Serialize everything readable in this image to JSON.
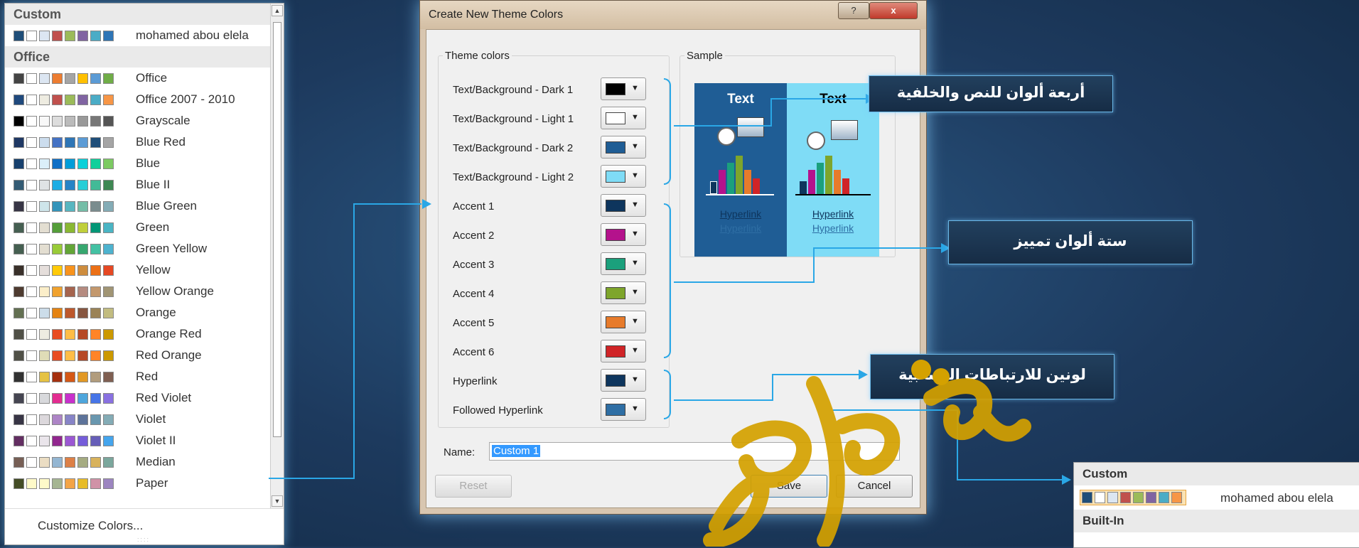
{
  "theme_menu": {
    "custom_header": "Custom",
    "custom_item": {
      "label": "mohamed abou elela",
      "swatches": [
        "#1f4e79",
        "#ffffff",
        "#dce6f2",
        "#c0504d",
        "#9bbb59",
        "#8064a2",
        "#4bacc6",
        "#2e75b6"
      ]
    },
    "office_header": "Office",
    "items": [
      {
        "label": "Office",
        "swatches": [
          "#444",
          "#fff",
          "#dce6f2",
          "#ed7d31",
          "#a5a5a5",
          "#ffc000",
          "#5b9bd5",
          "#70ad47"
        ]
      },
      {
        "label": "Office 2007 - 2010",
        "swatches": [
          "#1f497d",
          "#fff",
          "#eeece1",
          "#c0504d",
          "#9bbb59",
          "#8064a2",
          "#4bacc6",
          "#f79646"
        ]
      },
      {
        "label": "Grayscale",
        "swatches": [
          "#000",
          "#fff",
          "#f8f8f8",
          "#ddd",
          "#bbb",
          "#999",
          "#777",
          "#555"
        ]
      },
      {
        "label": "Blue Red",
        "swatches": [
          "#1f3864",
          "#fff",
          "#ccddee",
          "#4472c4",
          "#2e75b6",
          "#5b9bd5",
          "#1f4e79",
          "#a5a5a5"
        ]
      },
      {
        "label": "Blue",
        "swatches": [
          "#17406d",
          "#fff",
          "#dbeff9",
          "#0f6fc6",
          "#009dd9",
          "#0bd0d9",
          "#10cf9b",
          "#7cca62"
        ]
      },
      {
        "label": "Blue II",
        "swatches": [
          "#335b74",
          "#fff",
          "#dfe3e5",
          "#1cade4",
          "#2683c6",
          "#27ced7",
          "#42ba97",
          "#3e8853"
        ]
      },
      {
        "label": "Blue Green",
        "swatches": [
          "#373545",
          "#fff",
          "#cee5ea",
          "#3494ba",
          "#58b6c0",
          "#75bda7",
          "#7a8c8e",
          "#84acb6"
        ]
      },
      {
        "label": "Green",
        "swatches": [
          "#455f51",
          "#fff",
          "#e3ded1",
          "#549e39",
          "#8ab833",
          "#c0cf3a",
          "#029676",
          "#4ab5c4"
        ]
      },
      {
        "label": "Green Yellow",
        "swatches": [
          "#455f51",
          "#fff",
          "#e3ded1",
          "#99cb38",
          "#63a537",
          "#37a76f",
          "#44c1a3",
          "#4eb3cf"
        ]
      },
      {
        "label": "Yellow",
        "swatches": [
          "#39302a",
          "#fff",
          "#e5dedb",
          "#ffca08",
          "#f8931d",
          "#ce8d3e",
          "#ec7016",
          "#e64823"
        ]
      },
      {
        "label": "Yellow Orange",
        "swatches": [
          "#4e3b30",
          "#fff",
          "#fbeec9",
          "#f0a22e",
          "#a5644e",
          "#b58b80",
          "#c3986d",
          "#a19574"
        ]
      },
      {
        "label": "Orange",
        "swatches": [
          "#637052",
          "#fff",
          "#ccddea",
          "#e48312",
          "#bd582c",
          "#865640",
          "#9b8357",
          "#c2bc80"
        ]
      },
      {
        "label": "Orange Red",
        "swatches": [
          "#505046",
          "#fff",
          "#eeece1",
          "#e84c22",
          "#ffbd47",
          "#b64926",
          "#ff8427",
          "#cc9900"
        ]
      },
      {
        "label": "Red Orange",
        "swatches": [
          "#505046",
          "#fff",
          "#dfdcb7",
          "#e84c22",
          "#ffbd47",
          "#b64926",
          "#ff8427",
          "#cc9900"
        ]
      },
      {
        "label": "Red",
        "swatches": [
          "#323232",
          "#fff",
          "#e5c243",
          "#a5300f",
          "#d55816",
          "#e19825",
          "#b19c7d",
          "#7f5f52"
        ]
      },
      {
        "label": "Red Violet",
        "swatches": [
          "#454551",
          "#fff",
          "#d8d9dc",
          "#e32d91",
          "#c830cc",
          "#4ea6dc",
          "#4775e7",
          "#8971e1"
        ]
      },
      {
        "label": "Violet",
        "swatches": [
          "#373545",
          "#fff",
          "#dcd8dc",
          "#ad84c6",
          "#8784c7",
          "#5d739a",
          "#6997af",
          "#84acb6"
        ]
      },
      {
        "label": "Violet II",
        "swatches": [
          "#632e62",
          "#fff",
          "#eae5eb",
          "#92278f",
          "#9b57d3",
          "#755dd9",
          "#665eb8",
          "#45a5ed"
        ]
      },
      {
        "label": "Median",
        "swatches": [
          "#775f55",
          "#fff",
          "#ebddc3",
          "#94b6d2",
          "#dd8047",
          "#a5ab81",
          "#d8b25c",
          "#7ba79d"
        ]
      },
      {
        "label": "Paper",
        "swatches": [
          "#444d26",
          "#fefac9",
          "#fefac9",
          "#a5b592",
          "#f3a447",
          "#e7bc29",
          "#d092a7",
          "#9c85c0"
        ]
      }
    ],
    "customize_label": "Customize Colors...",
    "customize_mnemonic": "C"
  },
  "dialog": {
    "title": "Create New Theme Colors",
    "help_glyph": "?",
    "close_glyph": "x",
    "theme_colors_legend": "Theme colors",
    "sample_legend": "Sample",
    "color_rows": [
      {
        "label": "Text/Background - Dark 1",
        "color": "#000000"
      },
      {
        "label": "Text/Background - Light 1",
        "color": "#ffffff"
      },
      {
        "label": "Text/Background - Dark 2",
        "color": "#1f5d95"
      },
      {
        "label": "Text/Background - Light 2",
        "color": "#7fdcf6"
      },
      {
        "label": "Accent 1",
        "color": "#0e355d"
      },
      {
        "label": "Accent 2",
        "color": "#b4128c"
      },
      {
        "label": "Accent 3",
        "color": "#1ba07c"
      },
      {
        "label": "Accent 4",
        "color": "#7ea52b"
      },
      {
        "label": "Accent 5",
        "color": "#e77b2b"
      },
      {
        "label": "Accent 6",
        "color": "#d02427"
      },
      {
        "label": "Hyperlink",
        "color": "#0e355d"
      },
      {
        "label": "Followed Hyperlink",
        "color": "#2e6ea4"
      }
    ],
    "dropdown_glyph": "▼",
    "name_label": "Name:",
    "name_value": "Custom 1",
    "reset_label": "Reset",
    "save_label": "Save",
    "cancel_label": "Cancel",
    "sample": {
      "text_label": "Text",
      "hyperlink": "Hyperlink",
      "followed_hyperlink": "Hyperlink"
    }
  },
  "callouts": {
    "text_bg": "أربعة ألوان للنص والخلفية",
    "accents": "ستة ألوان تمييز",
    "hyperlinks": "لونين للارتباطات التشعبية"
  },
  "mini_panel": {
    "custom_header": "Custom",
    "item_label": "mohamed abou elela",
    "builtin_header": "Built-In",
    "swatches": [
      "#1f4e79",
      "#fff",
      "#dce6f2",
      "#c0504d",
      "#9bbb59",
      "#8064a2",
      "#4bacc6",
      "#f79646"
    ]
  },
  "colors": {
    "background": "#1f3a5c",
    "connector": "#2aa7e6",
    "watermark": "#d4a100"
  }
}
